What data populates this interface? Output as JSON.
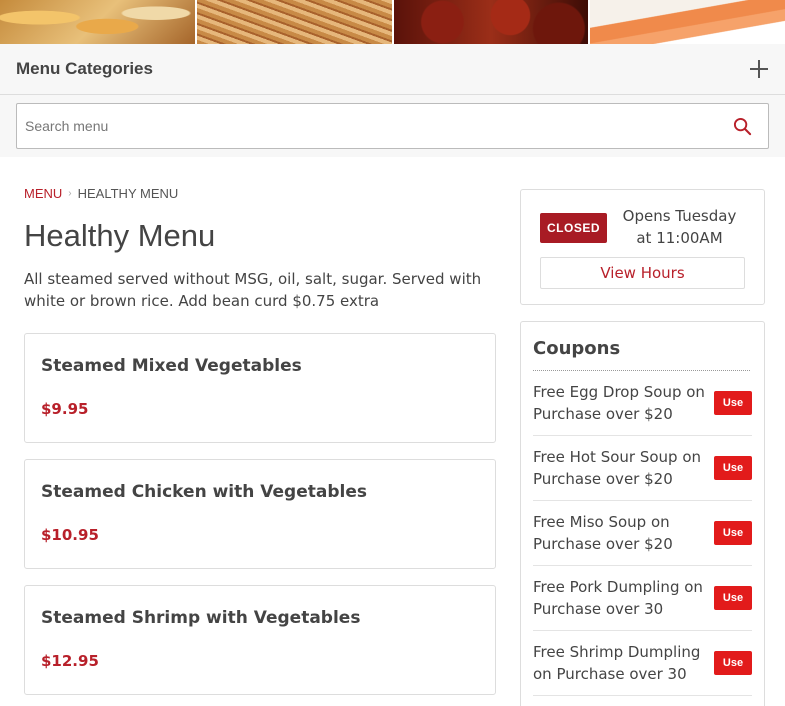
{
  "header": {
    "categories_label": "Menu Categories"
  },
  "search": {
    "placeholder": "Search menu"
  },
  "breadcrumb": {
    "root": "MENU",
    "current": "HEALTHY MENU"
  },
  "section": {
    "title": "Healthy Menu",
    "description": "All steamed served without MSG, oil, salt, sugar. Served with white or brown rice. Add bean curd $0.75 extra"
  },
  "items": [
    {
      "name": "Steamed Mixed Vegetables",
      "price": "$9.95"
    },
    {
      "name": "Steamed Chicken with Vegetables",
      "price": "$10.95"
    },
    {
      "name": "Steamed Shrimp with Vegetables",
      "price": "$12.95"
    }
  ],
  "hours": {
    "status": "CLOSED",
    "opens_line1": "Opens Tuesday",
    "opens_line2": "at 11:00AM",
    "view_hours_label": "View Hours"
  },
  "coupons": {
    "title": "Coupons",
    "use_label": "Use",
    "items": [
      "Free Egg Drop Soup on Purchase over $20",
      "Free Hot Sour Soup on Purchase over $20",
      "Free Miso Soup on Purchase over $20",
      "Free Pork Dumpling on Purchase over 30",
      "Free Shrimp Dumpling on Purchase over 30"
    ]
  },
  "colors": {
    "accent": "#b8202a",
    "closed_badge": "#a81b24",
    "use_button": "#e21b1b"
  },
  "icons": {
    "categories_toggle": "plus-icon",
    "search": "search-icon"
  }
}
